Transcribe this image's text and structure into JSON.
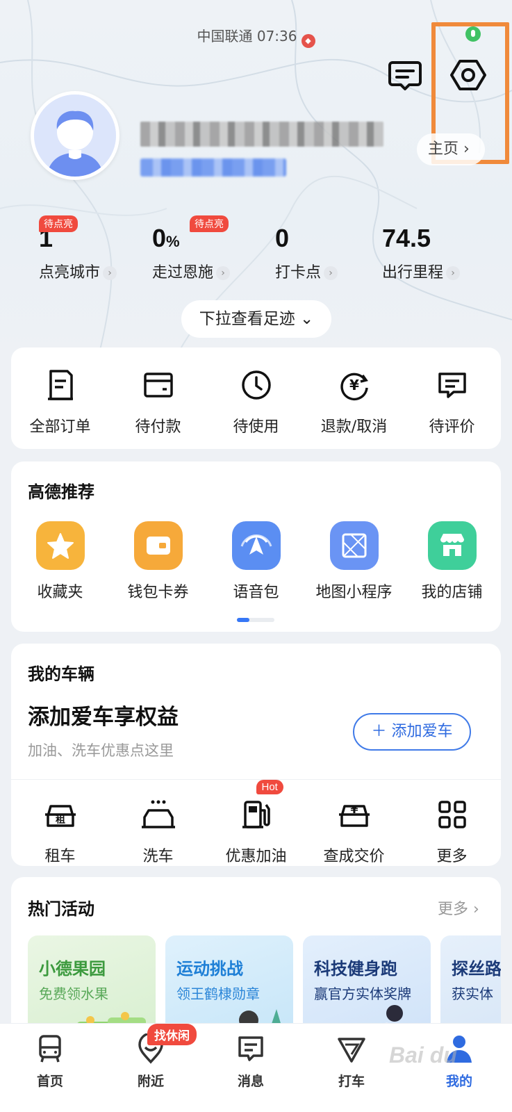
{
  "status_bar": {
    "carrier_time": "中国联通 07:36"
  },
  "profile": {
    "homepage_label": "主页 ›"
  },
  "stats": [
    {
      "value": "1",
      "label": "点亮城市",
      "badge": "待点亮"
    },
    {
      "value": "0",
      "unit": "%",
      "label": "走过恩施",
      "badge": "待点亮"
    },
    {
      "value": "0",
      "label": "打卡点"
    },
    {
      "value": "74.5",
      "label": "出行里程"
    }
  ],
  "pulldown": {
    "label": "下拉查看足迹 ⌄"
  },
  "orders": [
    {
      "label": "全部订单",
      "icon": "order-list-icon"
    },
    {
      "label": "待付款",
      "icon": "wallet-card-icon"
    },
    {
      "label": "待使用",
      "icon": "clock-icon"
    },
    {
      "label": "退款/取消",
      "icon": "refund-icon"
    },
    {
      "label": "待评价",
      "icon": "comment-icon"
    }
  ],
  "recommend": {
    "title": "高德推荐",
    "items": [
      {
        "label": "收藏夹",
        "icon": "star-icon",
        "color": "#f7b43c"
      },
      {
        "label": "钱包卡券",
        "icon": "wallet-icon",
        "color": "#f6a93a"
      },
      {
        "label": "语音包",
        "icon": "voice-nav-icon",
        "color": "#5b8ef2"
      },
      {
        "label": "地图小程序",
        "icon": "mini-program-icon",
        "color": "#6a94f4"
      },
      {
        "label": "我的店铺",
        "icon": "shop-icon",
        "color": "#3fcf9a"
      }
    ]
  },
  "vehicle": {
    "title": "我的车辆",
    "headline": "添加爱车享权益",
    "subtitle": "加油、洗车优惠点这里",
    "add_button": "＋ 添加爱车",
    "services": [
      {
        "label": "租车",
        "icon": "rent-car-icon"
      },
      {
        "label": "洗车",
        "icon": "car-wash-icon"
      },
      {
        "label": "优惠加油",
        "icon": "fuel-icon",
        "badge": "Hot"
      },
      {
        "label": "查成交价",
        "icon": "car-price-icon"
      },
      {
        "label": "更多",
        "icon": "grid-more-icon"
      }
    ]
  },
  "activities": {
    "title": "热门活动",
    "more": "更多 ›",
    "items": [
      {
        "title": "小德果园",
        "subtitle": "免费领水果",
        "color": "#3c9a3e",
        "bg": "#e3f4dd"
      },
      {
        "title": "运动挑战",
        "subtitle": "领王鹤棣勋章",
        "color": "#1e7fd6",
        "bg": "#d9eefb"
      },
      {
        "title": "科技健身跑",
        "subtitle": "赢官方实体奖牌",
        "color": "#1b3a78",
        "bg": "#dbeafb"
      },
      {
        "title": "探丝路",
        "subtitle": "获实体",
        "color": "#1b3a78",
        "bg": "#dde9f7"
      }
    ]
  },
  "bottom_nav": {
    "badge": "找休闲",
    "items": [
      {
        "label": "首页",
        "icon": "home-bus-icon"
      },
      {
        "label": "附近",
        "icon": "nearby-pin-icon"
      },
      {
        "label": "消息",
        "icon": "message-icon"
      },
      {
        "label": "打车",
        "icon": "taxi-icon"
      },
      {
        "label": "我的",
        "icon": "profile-icon",
        "active": true
      }
    ]
  },
  "colors": {
    "accent": "#2f6be0",
    "badge_red": "#f04a3e",
    "highlight": "#f08a3b"
  }
}
